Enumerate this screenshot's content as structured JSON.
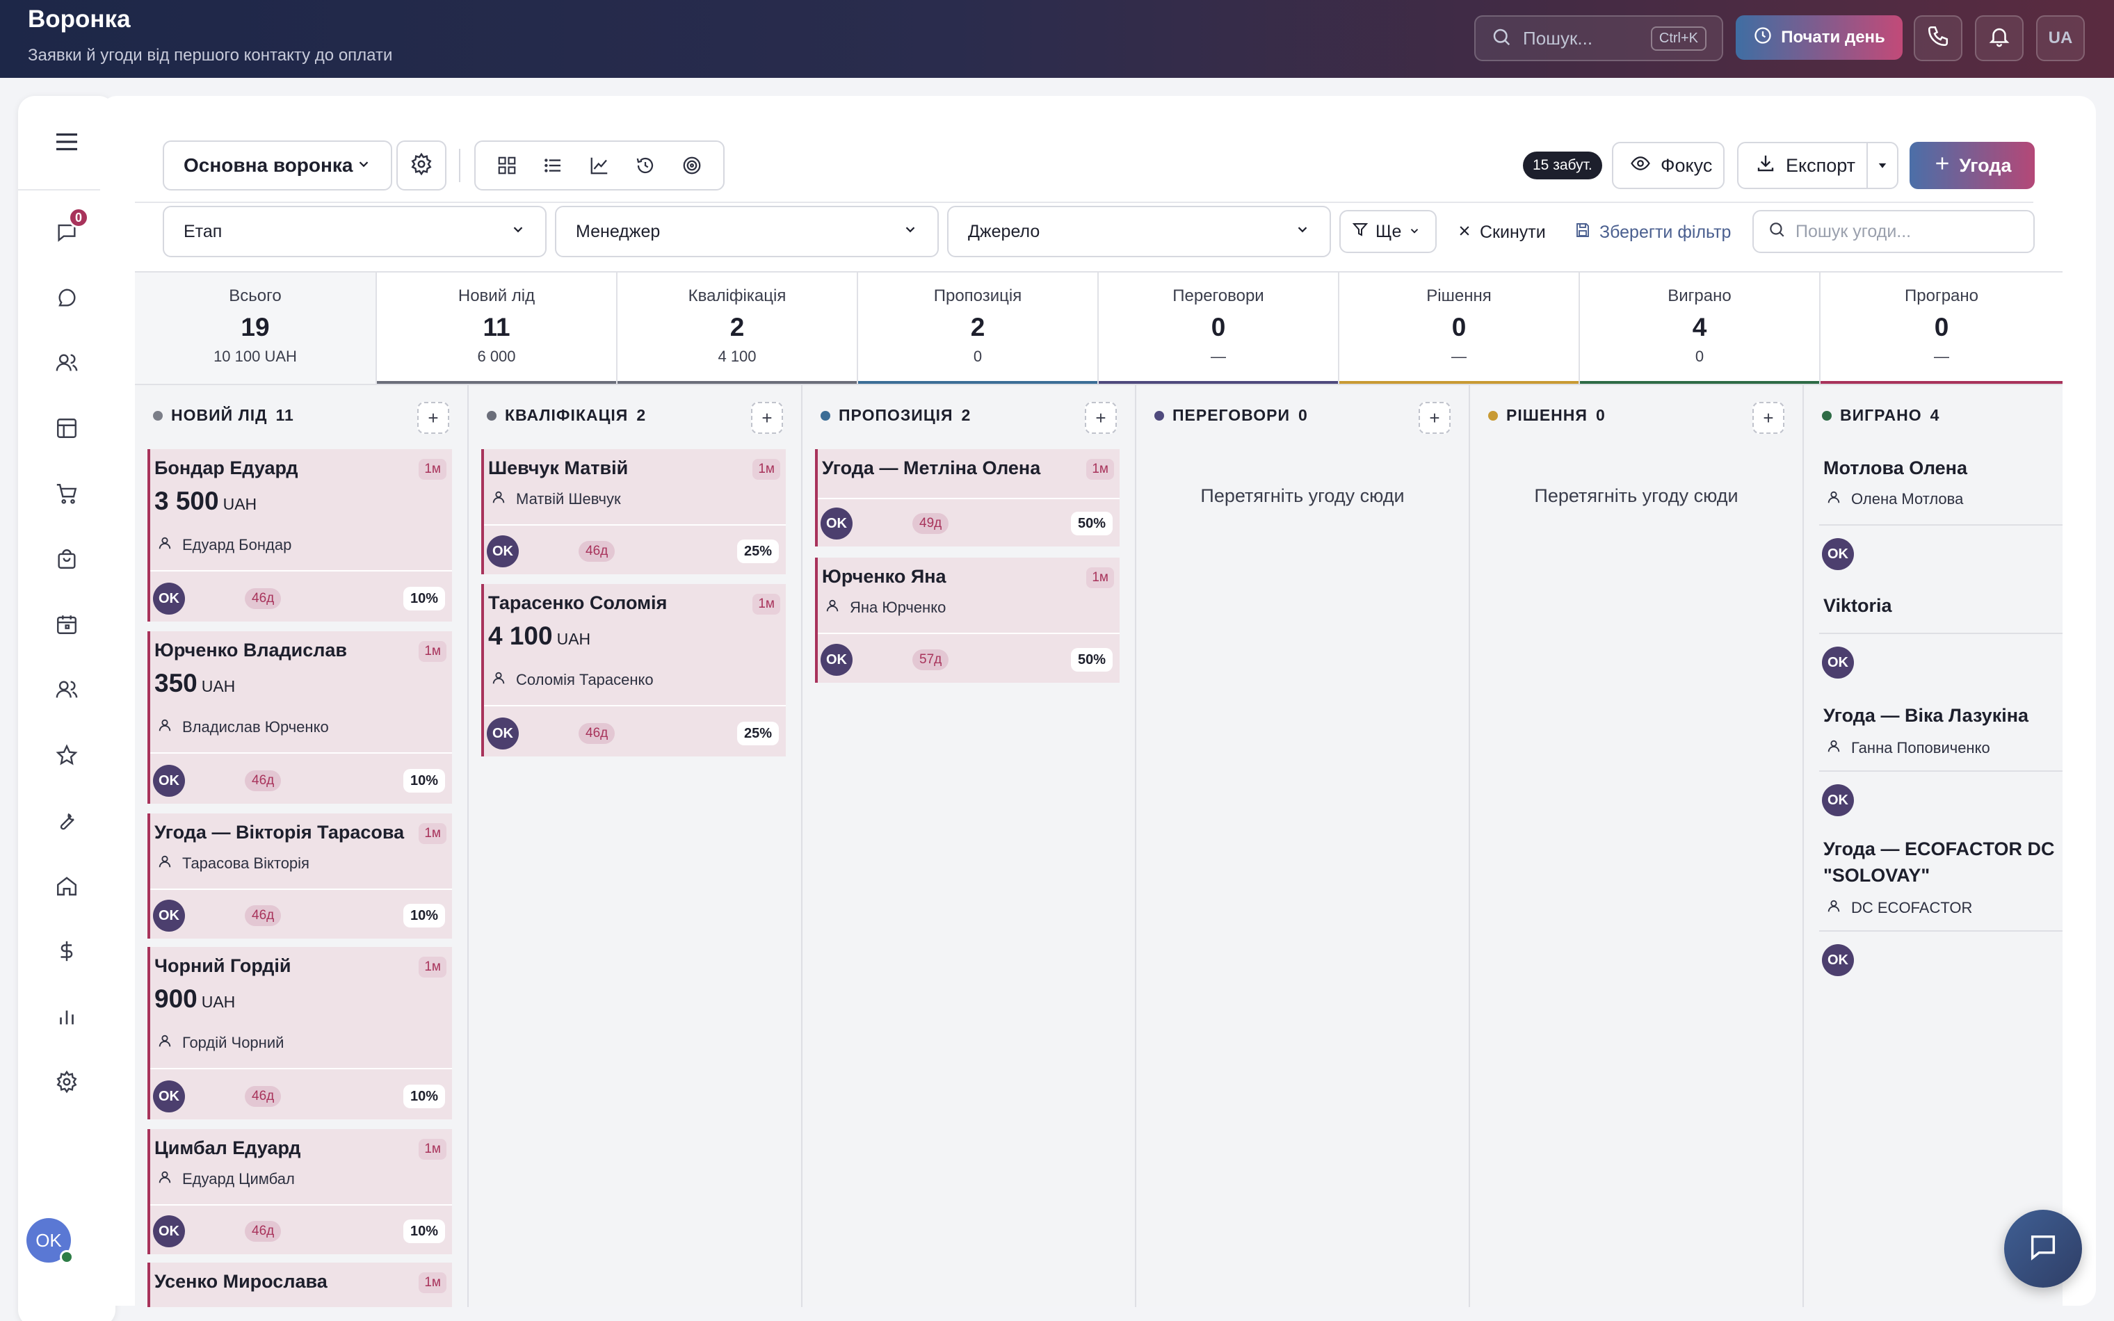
{
  "header": {
    "title": "Воронка",
    "subtitle": "Заявки й угоди від першого контакту до оплати",
    "search_placeholder": "Пошук...",
    "search_shortcut": "Ctrl+K",
    "start_day_label": "Почати день",
    "lang_label": "UA"
  },
  "sidebar": {
    "chat_badge": "0",
    "avatar_initials": "OK",
    "icons": [
      "menu-icon",
      "inbox-icon",
      "chat-bubble-icon",
      "users-icon",
      "layout-icon",
      "cart-icon",
      "bag-icon",
      "calendar-icon",
      "team-icon",
      "star-icon",
      "wrench-icon",
      "home-icon",
      "dollar-icon",
      "bar-chart-icon",
      "gear-icon"
    ]
  },
  "toolbar": {
    "pipeline_select": "Основна воронка",
    "forgotten_badge": "15 забут.",
    "focus_label": "Фокус",
    "export_label": "Експорт",
    "deal_label": "Угода"
  },
  "filters": {
    "stage": "Етап",
    "manager": "Менеджер",
    "source": "Джерело",
    "more": "Ще",
    "reset": "Скинути",
    "save_filter": "Зберегти фільтр",
    "deal_search_placeholder": "Пошук угоди..."
  },
  "stats": [
    {
      "label": "Всього",
      "count": "19",
      "sum": "10 100 UAH",
      "color": ""
    },
    {
      "label": "Новий лід",
      "count": "11",
      "sum": "6 000",
      "color": "#6b6e7a"
    },
    {
      "label": "Кваліфікація",
      "count": "2",
      "sum": "4 100",
      "color": "#6b6e7a"
    },
    {
      "label": "Пропозиція",
      "count": "2",
      "sum": "0",
      "color": "#3b6d96"
    },
    {
      "label": "Переговори",
      "count": "0",
      "sum": "—",
      "color": "#4f4a7d"
    },
    {
      "label": "Рішення",
      "count": "0",
      "sum": "—",
      "color": "#c89a34"
    },
    {
      "label": "Виграно",
      "count": "4",
      "sum": "0",
      "color": "#2e6b46"
    },
    {
      "label": "Програно",
      "count": "0",
      "sum": "—",
      "color": "#a8335b"
    }
  ],
  "columns": {
    "new": {
      "title": "НОВИЙ ЛІД",
      "count": "11",
      "dot": "#7b7e88"
    },
    "qual": {
      "title": "КВАЛІФІКАЦІЯ",
      "count": "2",
      "dot": "#6b6e7a"
    },
    "prop": {
      "title": "ПРОПОЗИЦІЯ",
      "count": "2",
      "dot": "#3b6d96"
    },
    "neg": {
      "title": "ПЕРЕГОВОРИ",
      "count": "0",
      "dot": "#4f4a7d",
      "empty": "Перетягніть угоду сюди"
    },
    "dec": {
      "title": "РІШЕННЯ",
      "count": "0",
      "dot": "#c89a34",
      "empty": "Перетягніть угоду сюди"
    },
    "won": {
      "title": "ВИГРАНО",
      "count": "4",
      "dot": "#2e6b46"
    }
  },
  "cards": {
    "new": [
      {
        "title": "Бондар Едуард",
        "age": "1м",
        "amount": "3 500",
        "currency": "UAH",
        "person": "Едуард Бондар",
        "owner": "OK",
        "days": "46д",
        "pct": "10%"
      },
      {
        "title": "Юрченко Владислав",
        "age": "1м",
        "amount": "350",
        "currency": "UAH",
        "person": "Владислав Юрченко",
        "owner": "OK",
        "days": "46д",
        "pct": "10%"
      },
      {
        "title": "Угода — Вікторія Тарасова",
        "age": "1м",
        "person": "Тарасова Вікторія",
        "owner": "OK",
        "days": "46д",
        "pct": "10%"
      },
      {
        "title": "Чорний Гордій",
        "age": "1м",
        "amount": "900",
        "currency": "UAH",
        "person": "Гордій Чорний",
        "owner": "OK",
        "days": "46д",
        "pct": "10%"
      },
      {
        "title": "Цимбал Едуард",
        "age": "1м",
        "person": "Едуард Цимбал",
        "owner": "OK",
        "days": "46д",
        "pct": "10%"
      },
      {
        "title": "Усенко Мирослава",
        "age": "1м"
      }
    ],
    "qual": [
      {
        "title": "Шевчук Матвій",
        "age": "1м",
        "person": "Матвій Шевчук",
        "owner": "OK",
        "days": "46д",
        "pct": "25%"
      },
      {
        "title": "Тарасенко Соломія",
        "age": "1м",
        "amount": "4 100",
        "currency": "UAH",
        "person": "Соломія Тарасенко",
        "owner": "OK",
        "days": "46д",
        "pct": "25%"
      }
    ],
    "prop": [
      {
        "title": "Угода — Метліна Олена",
        "age": "1м",
        "owner": "OK",
        "days": "49д",
        "pct": "50%"
      },
      {
        "title": "Юрченко Яна",
        "age": "1м",
        "person": "Яна Юрченко",
        "owner": "OK",
        "days": "57д",
        "pct": "50%"
      }
    ],
    "won": [
      {
        "title": "Мотлова Олена",
        "person": "Олена Мотлова",
        "owner": "OK"
      },
      {
        "title": "Viktoria",
        "owner": "OK"
      },
      {
        "title": "Угода — Віка Лазукіна",
        "person": "Ганна Поповиченко",
        "owner": "OK"
      },
      {
        "title": "Угода — ECOFACTOR DC",
        "title2": "\"SOLOVAY\"",
        "person": "DC ECOFACTOR",
        "owner": "OK"
      }
    ]
  }
}
